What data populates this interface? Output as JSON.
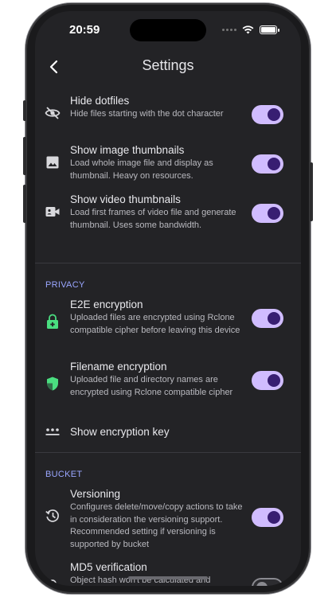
{
  "status_bar": {
    "time": "20:59"
  },
  "app_bar": {
    "title": "Settings"
  },
  "general": [
    {
      "title": "Hide dotfiles",
      "description": "Hide files starting with the dot character",
      "icon": "eye-off-icon",
      "enabled": true
    },
    {
      "title": "Show image thumbnails",
      "description": "Load whole image file and display as thumbnail. Heavy on resources.",
      "icon": "image-icon",
      "enabled": true
    },
    {
      "title": "Show video thumbnails",
      "description": "Load first frames of video file and generate thumbnail. Uses some bandwidth.",
      "icon": "video-icon",
      "enabled": true
    }
  ],
  "privacy": {
    "header": "PRIVACY",
    "items": [
      {
        "title": "E2E encryption",
        "description": "Uploaded files are encrypted using Rclone compatible cipher before leaving this device",
        "icon": "lock-plus-icon",
        "enabled": true
      },
      {
        "title": "Filename encryption",
        "description": "Uploaded file and directory names are encrypted using Rclone compatible cipher",
        "icon": "shield-icon",
        "enabled": true
      }
    ],
    "show_key": {
      "title": "Show encryption key",
      "icon": "password-dots-icon"
    }
  },
  "bucket": {
    "header": "BUCKET",
    "items": [
      {
        "title": "Versioning",
        "description": "Configures delete/move/copy actions to take in consideration the versioning support. Recommended setting if versioning is supported by bucket",
        "icon": "history-icon",
        "enabled": true
      },
      {
        "title": "MD5 verification",
        "description": "Object hash won't be calculated and",
        "icon": "pin-icon",
        "enabled": false
      }
    ]
  },
  "colors": {
    "accent": "#d0bcff",
    "toggle_knob": "#381e72",
    "background": "#232326",
    "section_header": "#9aa6ff",
    "green_icon": "#4ade80"
  }
}
